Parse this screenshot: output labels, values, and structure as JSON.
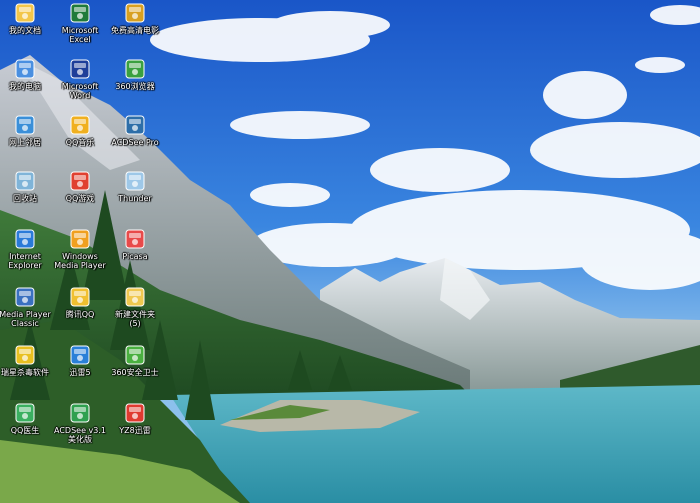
{
  "desktop": {
    "wallpaper": "mountain-lake-scenery",
    "icons": [
      {
        "id": "my-documents",
        "label": "我的文档",
        "icon": "folder-documents-icon",
        "color": "#f3c64a"
      },
      {
        "id": "excel",
        "label": "Microsoft\nExcel",
        "icon": "excel-icon",
        "color": "#1f7a3a"
      },
      {
        "id": "hd-movies",
        "label": "免费高清电影",
        "icon": "film-icon",
        "color": "#d8a020"
      },
      {
        "id": "my-computer",
        "label": "我的电脑",
        "icon": "computer-icon",
        "color": "#4a8fe0"
      },
      {
        "id": "word",
        "label": "Microsoft\nWord",
        "icon": "word-icon",
        "color": "#1f3f9a"
      },
      {
        "id": "360-browser",
        "label": "360浏览器",
        "icon": "browser-icon",
        "color": "#3aa040"
      },
      {
        "id": "network",
        "label": "网上邻居",
        "icon": "network-icon",
        "color": "#3a8fd8"
      },
      {
        "id": "qq-music",
        "label": "QQ音乐",
        "icon": "music-icon",
        "color": "#f0b020"
      },
      {
        "id": "acdsee-pro",
        "label": "ACDSee Pro",
        "icon": "acdsee-icon",
        "color": "#2d6ea8"
      },
      {
        "id": "recycle-bin",
        "label": "回收站",
        "icon": "recycle-bin-icon",
        "color": "#7fb4d8"
      },
      {
        "id": "qq-games",
        "label": "QQ游戏",
        "icon": "game-icon",
        "color": "#e04030"
      },
      {
        "id": "thunder-file",
        "label": "Thunder",
        "icon": "file-icon",
        "color": "#9ec8e8"
      },
      {
        "id": "ie",
        "label": "Internet\nExplorer",
        "icon": "ie-icon",
        "color": "#2a7ad8"
      },
      {
        "id": "wmp",
        "label": "Windows\nMedia Player",
        "icon": "media-player-icon",
        "color": "#f0a020"
      },
      {
        "id": "picasa",
        "label": "Picasa",
        "icon": "picasa-icon",
        "color": "#e84a4a"
      },
      {
        "id": "mpc",
        "label": "Media Player\nClassic",
        "icon": "mpc-icon",
        "color": "#3a70c0"
      },
      {
        "id": "tencent-qq",
        "label": "腾讯QQ",
        "icon": "qq-penguin-icon",
        "color": "#f0c030"
      },
      {
        "id": "new-folder",
        "label": "新建文件夹\n(5)",
        "icon": "folder-icon",
        "color": "#f0c850"
      },
      {
        "id": "rising-av",
        "label": "瑞星杀毒软件",
        "icon": "antivirus-icon",
        "color": "#e8c020"
      },
      {
        "id": "xunlei",
        "label": "迅雷5",
        "icon": "thunder-icon",
        "color": "#2a80d8"
      },
      {
        "id": "360-safe",
        "label": "360安全卫士",
        "icon": "shield-icon",
        "color": "#4ab040"
      },
      {
        "id": "qq-doctor",
        "label": "QQ医生",
        "icon": "doctor-shield-icon",
        "color": "#3ab060"
      },
      {
        "id": "acdsee-31",
        "label": "ACDSee v3.1\n美化版",
        "icon": "acdsee-eye-icon",
        "color": "#30a050"
      },
      {
        "id": "xunlei-2",
        "label": "YZ8迅雷",
        "icon": "thunder-bird-icon",
        "color": "#e03a30"
      }
    ]
  }
}
